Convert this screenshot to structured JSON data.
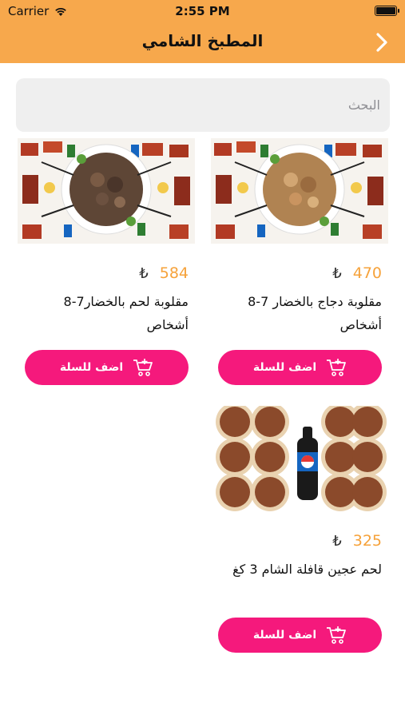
{
  "status_bar": {
    "carrier": "Carrier",
    "time": "2:55 PM"
  },
  "nav": {
    "title": "المطبخ الشامي"
  },
  "search": {
    "placeholder": "البحث"
  },
  "colors": {
    "header": "#f7a84c",
    "price": "#f6a23a",
    "button": "#f5197c",
    "search_bg": "#efefef"
  },
  "currency_symbol": "₺",
  "products": [
    {
      "name": "مقلوبة دجاج بالخضار 7-8 أشخاص",
      "price": "470",
      "button": "اضف للسلة",
      "image": "platter-chicken"
    },
    {
      "name": "مقلوبة لحم بالخضار7-8 أشخاص",
      "price": "584",
      "button": "اضف للسلة",
      "image": "platter-meat"
    },
    {
      "name": "لحم عجين قافلة الشام 3 كغ",
      "price": "325",
      "button": "اضف للسلة",
      "image": "lahm-bi-ajin"
    }
  ]
}
